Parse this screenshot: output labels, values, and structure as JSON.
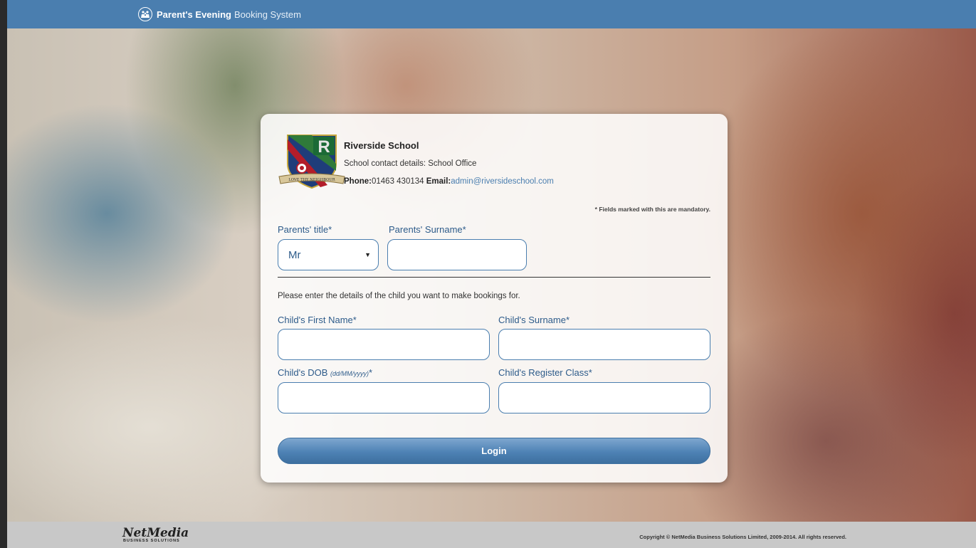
{
  "header": {
    "title_bold": "Parent's Evening",
    "title_light": "Booking System"
  },
  "school": {
    "name": "Riverside School",
    "contact": "School contact details: School Office",
    "phone_label": "Phone:",
    "phone": "01463 430134",
    "email_label": "Email:",
    "email": "admin@riversideschool.com",
    "crest_motto": "LOVE THY NEIGHBOUR",
    "crest_letter": "R"
  },
  "form": {
    "mandatory_note": "* Fields marked with this are mandatory.",
    "parents_title_label": "Parents' title*",
    "parents_title_value": "Mr",
    "parents_surname_label": "Parents' Surname*",
    "instruction": "Please enter the details of the child you want to make bookings for.",
    "child_first_name_label": "Child's First Name*",
    "child_surname_label": "Child's Surname*",
    "child_dob_label": "Child's DOB",
    "child_dob_hint": "(dd/MM/yyyy)",
    "child_dob_star": "*",
    "child_register_label": "Child's Register Class*",
    "login_label": "Login"
  },
  "footer": {
    "brand": "NetMedia",
    "brand_sub": "BUSINESS SOLUTIONS",
    "copyright": "Copyright © NetMedia Business Solutions Limited, 2009-2014. All rights reserved."
  },
  "colors": {
    "accent": "#4a7eaf",
    "label": "#2d5b8a",
    "footer": "#c8c8c8"
  }
}
